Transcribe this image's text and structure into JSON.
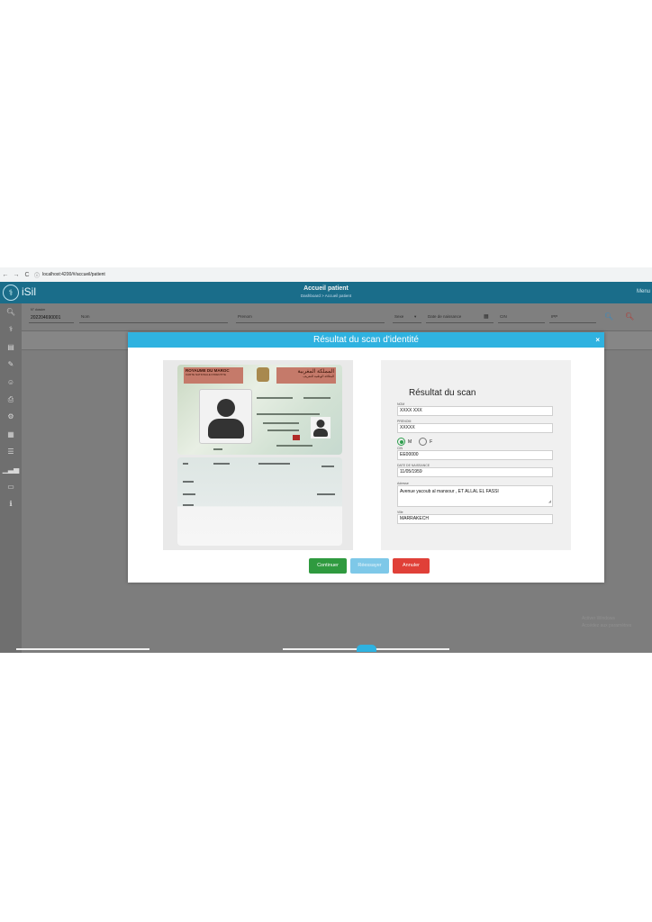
{
  "browser": {
    "back": "←",
    "forward": "→",
    "reload": "C",
    "info_icon": "ⓘ",
    "url": "localhost:4200/#/accueil/patient"
  },
  "header": {
    "logo": "iSil",
    "title": "Accueil patient",
    "breadcrumb": "Dashboard > Accueil patient",
    "menu": "Menu"
  },
  "sidebar": {
    "icons": [
      "search-icon",
      "stethoscope-icon",
      "file-icon",
      "edit-icon",
      "user-icon",
      "printer-icon",
      "settings-icon",
      "calculator-icon",
      "list-icon",
      "chart-icon",
      "monitor-icon",
      "info-icon"
    ]
  },
  "search": {
    "dossier_label": "N° dossier",
    "dossier_value": "202204690001",
    "nom_ph": "Nom",
    "prenom_ph": "Prenom",
    "sexe": "Sexe",
    "naissance_ph": "Date de naissance",
    "cin_ph": "CIN",
    "ipp_ph": "IPP"
  },
  "modal": {
    "title": "Résultat du scan d'identité",
    "close": "×"
  },
  "card": {
    "front_fr": "ROYAUME DU MAROC",
    "front_fr_sub": "CARTE NATIONALE D'IDENTITE",
    "front_ar": "المملكة المغربية",
    "front_ar_sub": "البطاقة الوطنية للتعريف"
  },
  "result": {
    "title": "Résultat du scan",
    "nom_label": "NOM",
    "nom_value": "XXXX XXX",
    "prenom_label": "PRENOM",
    "prenom_value": "XXXXX",
    "sexe_m": "M",
    "sexe_f": "F",
    "sexe_selected": "M",
    "cin_label": "CIN",
    "cin_value": "EE00000",
    "naissance_label": "DATE DE NAISSANCE",
    "naissance_value": "11/05/1959",
    "adresse_label": "Adresse",
    "adresse_value": "Avenue yacoub al mansour , ET ALLAL EL FASSI",
    "ville_label": "Ville",
    "ville_value": "MARRAKECH"
  },
  "buttons": {
    "continue": "Continuer",
    "retry": "Réessayer",
    "cancel": "Annuler"
  },
  "watermark": {
    "line1": "Activer Windows",
    "line2": "Accédez aux paramètres"
  },
  "colors": {
    "header": "#1a6d8a",
    "modal_head": "#2fb2e0",
    "continue": "#2f9a3f",
    "retry": "#7ec8e8",
    "cancel": "#e04038",
    "radio_on": "#2e9e4e"
  }
}
